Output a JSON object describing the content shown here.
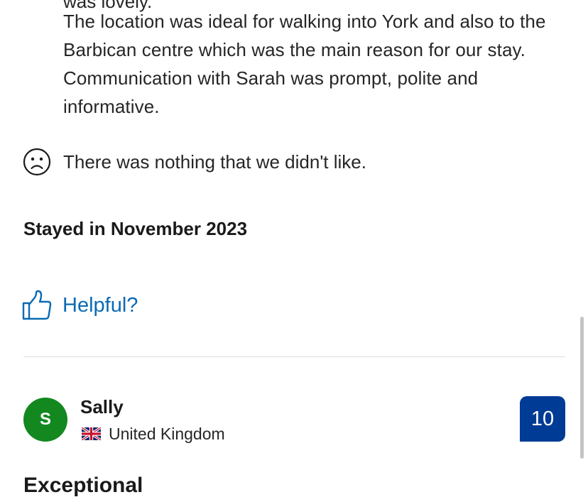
{
  "review": {
    "positive_clipped_line": "was lovely.",
    "positive_text": "The location was ideal for walking into York and also to the Barbican centre which was the main reason for our stay. Communication  with Sarah was prompt, polite and informative.",
    "negative_text": "There was nothing that we didn't like.",
    "stayed_text": "Stayed in November 2023",
    "helpful_label": "Helpful?"
  },
  "next_review": {
    "avatar_initial": "S",
    "reviewer_name": "Sally",
    "country": "United Kingdom",
    "score": "10",
    "verdict": "Exceptional"
  },
  "icons": {
    "negative": "sad-face-icon",
    "helpful": "thumbs-up-icon",
    "country_flag": "uk-flag-icon"
  },
  "colors": {
    "link_blue": "#0a6ab5",
    "score_badge": "#003b95",
    "avatar_green": "#13881f",
    "divider": "#dddddd"
  }
}
